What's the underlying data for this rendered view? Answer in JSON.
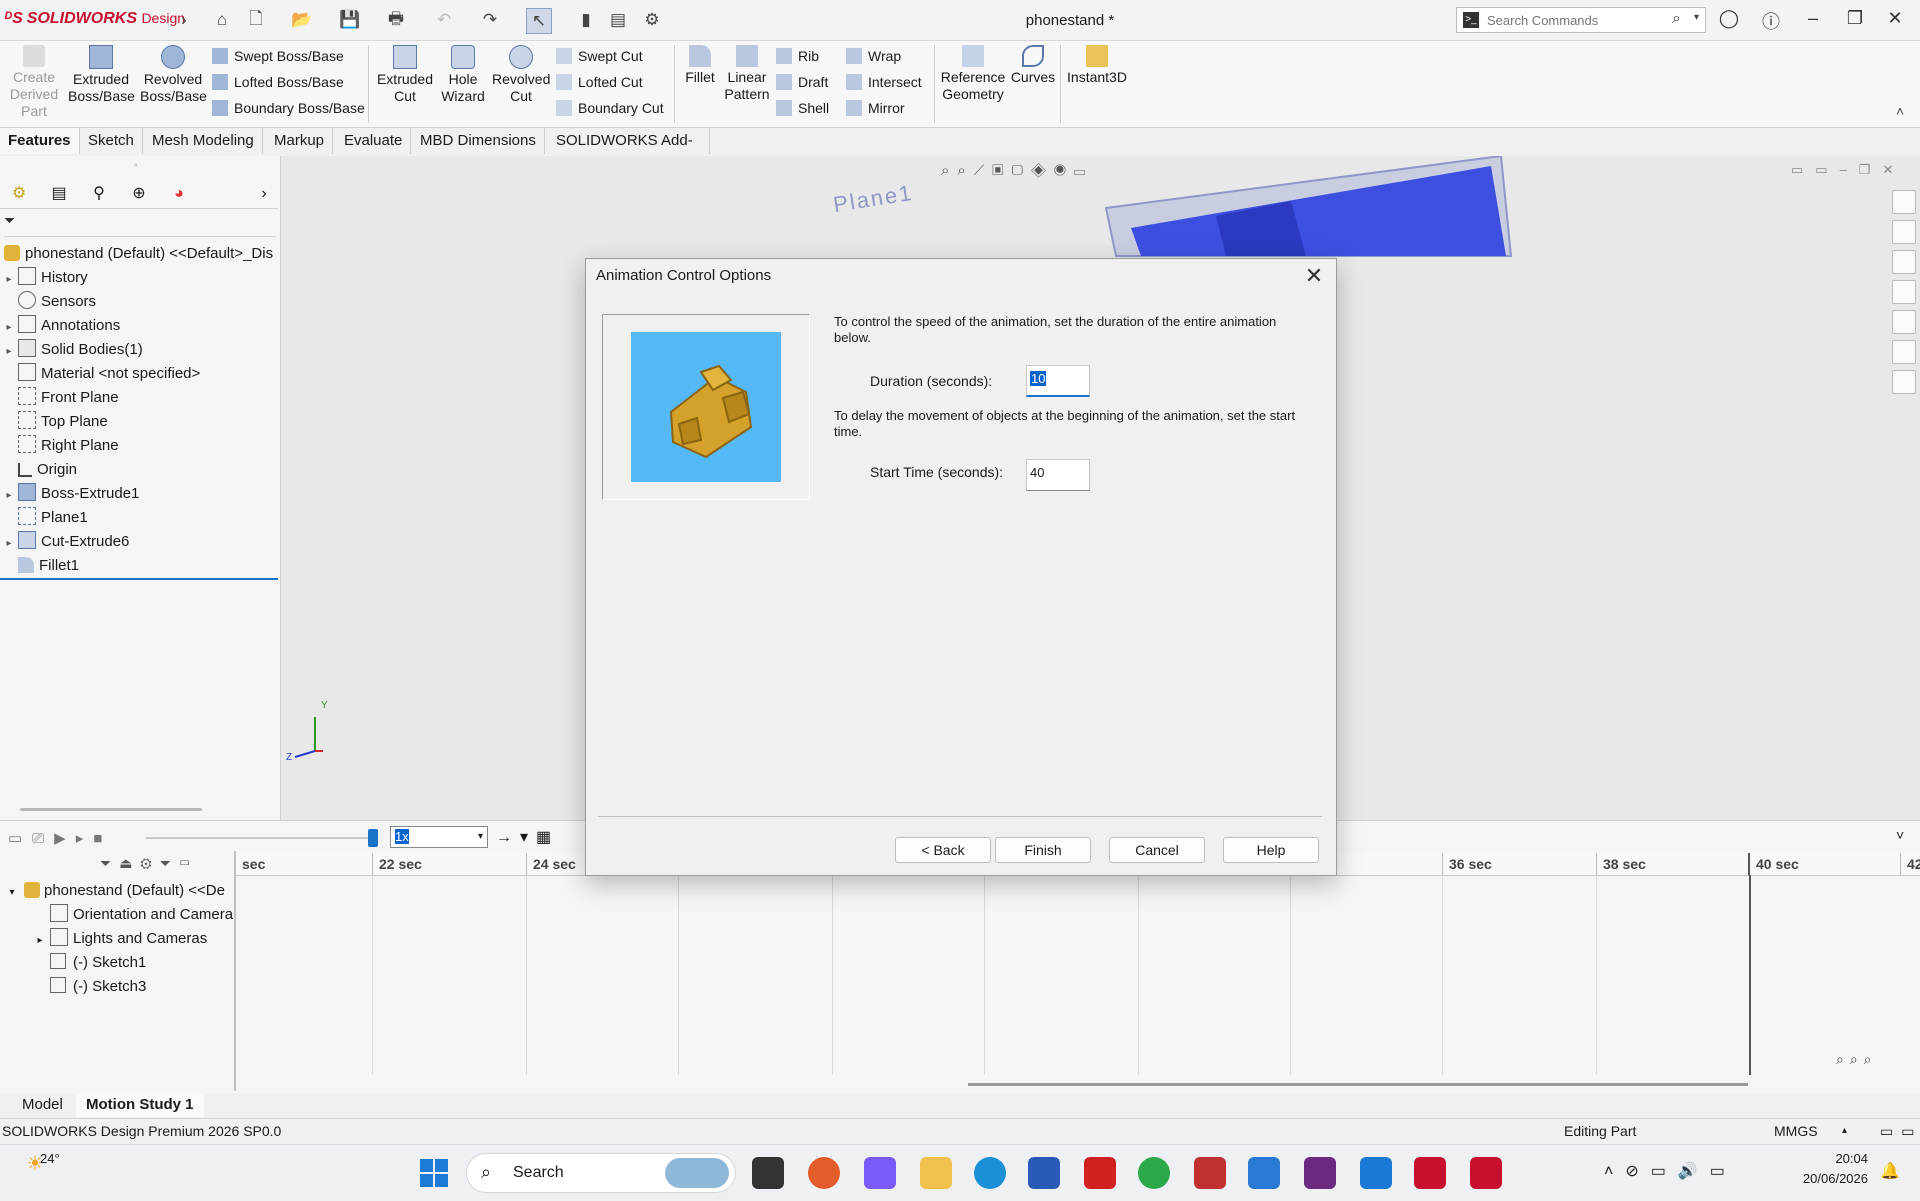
{
  "app": {
    "brand": "SOLIDWORKS",
    "brand_suffix": "Design",
    "document_title": "phonestand *",
    "search_placeholder": "Search Commands"
  },
  "ribbon": {
    "create_derived_part": "Create Derived Part",
    "extruded_boss": "Extruded Boss/Base",
    "revolved_boss": "Revolved Boss/Base",
    "swept_boss": "Swept Boss/Base",
    "lofted_boss": "Lofted Boss/Base",
    "boundary_boss": "Boundary Boss/Base",
    "extruded_cut": "Extruded Cut",
    "hole_wizard": "Hole Wizard",
    "revolved_cut": "Revolved Cut",
    "swept_cut": "Swept Cut",
    "lofted_cut": "Lofted Cut",
    "boundary_cut": "Boundary Cut",
    "fillet": "Fillet",
    "linear_pattern": "Linear Pattern",
    "rib": "Rib",
    "draft": "Draft",
    "shell": "Shell",
    "wrap": "Wrap",
    "intersect": "Intersect",
    "mirror": "Mirror",
    "reference_geometry": "Reference Geometry",
    "curves": "Curves",
    "instant3d": "Instant3D"
  },
  "tabs": [
    "Features",
    "Sketch",
    "Mesh Modeling",
    "Markup",
    "Evaluate",
    "MBD Dimensions",
    "SOLIDWORKS Add-Ins"
  ],
  "tree": {
    "root": "phonestand (Default) <<Default>_Dis",
    "items": [
      "History",
      "Sensors",
      "Annotations",
      "Solid Bodies(1)",
      "Material <not specified>",
      "Front Plane",
      "Top Plane",
      "Right Plane",
      "Origin",
      "Boss-Extrude1",
      "Plane1",
      "Cut-Extrude6",
      "Fillet1"
    ]
  },
  "viewport": {
    "plane_label": "Plane1",
    "axis_y": "Y",
    "axis_z": "Z"
  },
  "motion": {
    "speed": "1x",
    "tree_root": "phonestand (Default) <<De",
    "tree_items": [
      "Orientation and Camera",
      "Lights and Cameras",
      "(-) Sketch1",
      "(-) Sketch3"
    ],
    "ruler": [
      "sec",
      "22 sec",
      "24 sec",
      "36 sec",
      "38 sec",
      "40 sec",
      "42"
    ]
  },
  "bottom_tabs": [
    "Model",
    "Motion Study 1"
  ],
  "status": {
    "product": "SOLIDWORKS Design Premium 2026 SP0.0",
    "mode": "Editing Part",
    "units": "MMGS"
  },
  "taskbar": {
    "temperature": "24°",
    "search": "Search",
    "time": "20:04",
    "date": "20/06/2026"
  },
  "dialog": {
    "title": "Animation Control Options",
    "duration_text": "To control the speed of the animation, set the duration of the entire animation below.",
    "duration_label": "Duration (seconds):",
    "duration_value": "10",
    "delay_text": "To delay the movement of objects at the beginning of the animation, set the start time.",
    "start_label": "Start Time (seconds):",
    "start_value": "40",
    "back": "< Back",
    "finish": "Finish",
    "cancel": "Cancel",
    "help": "Help"
  },
  "colors": {
    "brand_red": "#c8102e",
    "preview_bg": "#55b8f7",
    "model_blue": "#3d4fe0",
    "selection": "#0a64d0"
  }
}
